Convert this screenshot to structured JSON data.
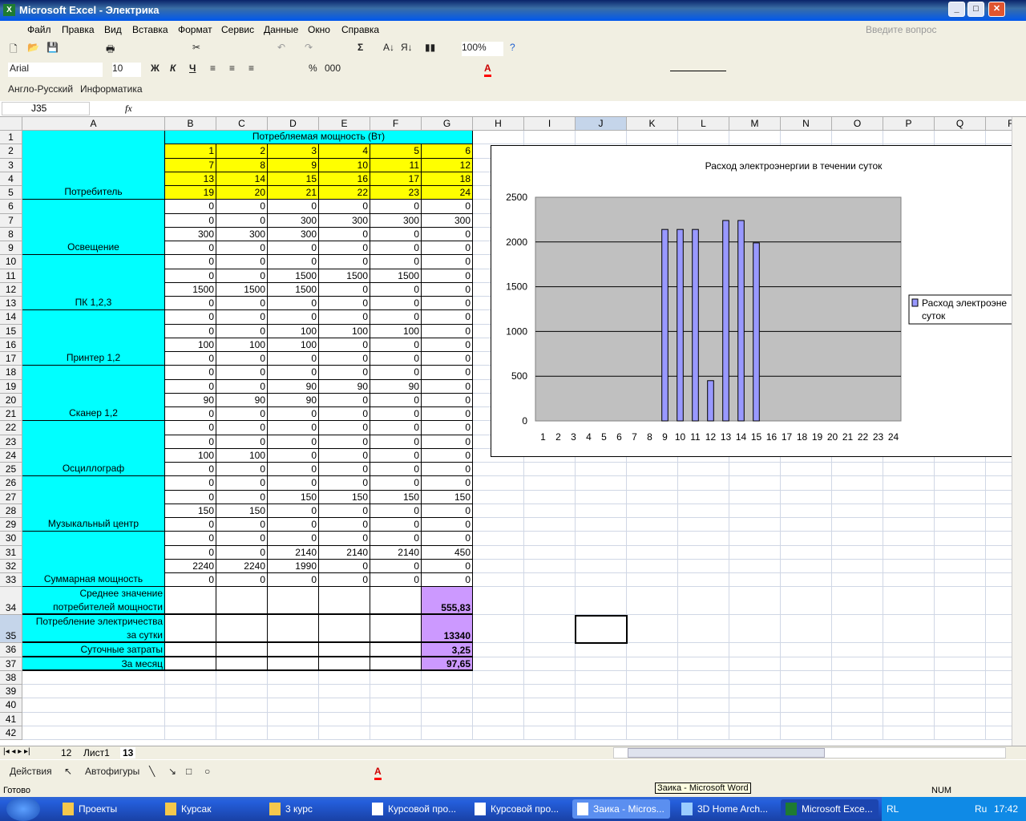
{
  "window": {
    "title": "Microsoft Excel - Электрика",
    "help_placeholder": "Введите вопрос"
  },
  "menu": [
    "Файл",
    "Правка",
    "Вид",
    "Вставка",
    "Формат",
    "Сервис",
    "Данные",
    "Окно",
    "Справка"
  ],
  "toolbar": {
    "zoom": "100%",
    "font": "Arial",
    "size": "10",
    "bold": "Ж",
    "italic": "К",
    "underline": "Ч",
    "percent": "%",
    "thousands": "000",
    "sum": "Σ"
  },
  "toolbar3": {
    "dict": "Англо-Русский",
    "info": "Информатика"
  },
  "formula": {
    "name_box": "J35",
    "fx": "fx",
    "value": ""
  },
  "columns": [
    "A",
    "B",
    "C",
    "D",
    "E",
    "F",
    "G",
    "H",
    "I",
    "J",
    "K",
    "L",
    "M",
    "N",
    "O",
    "P",
    "Q",
    "R"
  ],
  "colors": {
    "cyan": "#00FFFF",
    "yellow": "#FFFF00",
    "purple": "#CC99FF",
    "bar": "#9999FF",
    "plot": "#C0C0C0"
  },
  "sheet": {
    "header": "Потребляемая мощность (Вт)",
    "groups": [
      {
        "label": "Потребитель",
        "start": 1,
        "end": 5
      },
      {
        "label": "Освещение",
        "start": 6,
        "end": 9
      },
      {
        "label": "ПК 1,2,3",
        "start": 10,
        "end": 13
      },
      {
        "label": "Принтер 1,2",
        "start": 14,
        "end": 17
      },
      {
        "label": "Сканер 1,2",
        "start": 18,
        "end": 21
      },
      {
        "label": "Осциллограф",
        "start": 22,
        "end": 25
      },
      {
        "label": "Музыкальный центр",
        "start": 26,
        "end": 29
      },
      {
        "label": "Суммарная мощность",
        "start": 30,
        "end": 33
      }
    ],
    "rows": {
      "2": [
        "1",
        "2",
        "3",
        "4",
        "5",
        "6"
      ],
      "3": [
        "7",
        "8",
        "9",
        "10",
        "11",
        "12"
      ],
      "4": [
        "13",
        "14",
        "15",
        "16",
        "17",
        "18"
      ],
      "5": [
        "19",
        "20",
        "21",
        "22",
        "23",
        "24"
      ],
      "6": [
        "0",
        "0",
        "0",
        "0",
        "0",
        "0"
      ],
      "7": [
        "0",
        "0",
        "300",
        "300",
        "300",
        "300"
      ],
      "8": [
        "300",
        "300",
        "300",
        "0",
        "0",
        "0"
      ],
      "9": [
        "0",
        "0",
        "0",
        "0",
        "0",
        "0"
      ],
      "10": [
        "0",
        "0",
        "0",
        "0",
        "0",
        "0"
      ],
      "11": [
        "0",
        "0",
        "1500",
        "1500",
        "1500",
        "0"
      ],
      "12": [
        "1500",
        "1500",
        "1500",
        "0",
        "0",
        "0"
      ],
      "13": [
        "0",
        "0",
        "0",
        "0",
        "0",
        "0"
      ],
      "14": [
        "0",
        "0",
        "0",
        "0",
        "0",
        "0"
      ],
      "15": [
        "0",
        "0",
        "100",
        "100",
        "100",
        "0"
      ],
      "16": [
        "100",
        "100",
        "100",
        "0",
        "0",
        "0"
      ],
      "17": [
        "0",
        "0",
        "0",
        "0",
        "0",
        "0"
      ],
      "18": [
        "0",
        "0",
        "0",
        "0",
        "0",
        "0"
      ],
      "19": [
        "0",
        "0",
        "90",
        "90",
        "90",
        "0"
      ],
      "20": [
        "90",
        "90",
        "90",
        "0",
        "0",
        "0"
      ],
      "21": [
        "0",
        "0",
        "0",
        "0",
        "0",
        "0"
      ],
      "22": [
        "0",
        "0",
        "0",
        "0",
        "0",
        "0"
      ],
      "23": [
        "0",
        "0",
        "0",
        "0",
        "0",
        "0"
      ],
      "24": [
        "100",
        "100",
        "0",
        "0",
        "0",
        "0"
      ],
      "25": [
        "0",
        "0",
        "0",
        "0",
        "0",
        "0"
      ],
      "26": [
        "0",
        "0",
        "0",
        "0",
        "0",
        "0"
      ],
      "27": [
        "0",
        "0",
        "150",
        "150",
        "150",
        "150"
      ],
      "28": [
        "150",
        "150",
        "0",
        "0",
        "0",
        "0"
      ],
      "29": [
        "0",
        "0",
        "0",
        "0",
        "0",
        "0"
      ],
      "30": [
        "0",
        "0",
        "0",
        "0",
        "0",
        "0"
      ],
      "31": [
        "0",
        "0",
        "2140",
        "2140",
        "2140",
        "450"
      ],
      "32": [
        "2240",
        "2240",
        "1990",
        "0",
        "0",
        "0"
      ],
      "33": [
        "0",
        "0",
        "0",
        "0",
        "0",
        "0"
      ]
    },
    "summary": [
      {
        "row": 34,
        "label": "Среднее значение потребителей мощности",
        "value": "555,83"
      },
      {
        "row": 35,
        "label": "Потребление электричества за сутки",
        "value": "13340"
      },
      {
        "row": 36,
        "label": "Суточные затраты",
        "value": "3,25"
      },
      {
        "row": 37,
        "label": "За месяц",
        "value": "97,65"
      }
    ]
  },
  "chart_data": {
    "type": "bar",
    "title": "Расход электроэнергии в течении суток",
    "categories": [
      "1",
      "2",
      "3",
      "4",
      "5",
      "6",
      "7",
      "8",
      "9",
      "10",
      "11",
      "12",
      "13",
      "14",
      "15",
      "16",
      "17",
      "18",
      "19",
      "20",
      "21",
      "22",
      "23",
      "24"
    ],
    "series": [
      {
        "name": "Расход электроэнергии в течении суток",
        "values": [
          0,
          0,
          0,
          0,
          0,
          0,
          0,
          0,
          2140,
          2140,
          2140,
          450,
          2240,
          2240,
          1990,
          0,
          0,
          0,
          0,
          0,
          0,
          0,
          0,
          0
        ]
      }
    ],
    "legend_visible_text": [
      "Расход электроэне",
      "суток"
    ],
    "ylim": [
      0,
      2500
    ],
    "yticks": [
      "0",
      "500",
      "1000",
      "1500",
      "2000",
      "2500"
    ],
    "grid": true,
    "legend": "right"
  },
  "sheet_tabs": [
    "12",
    "Лист1",
    "13"
  ],
  "drawing": {
    "actions": "Действия",
    "autoshapes": "Автофигуры"
  },
  "status": {
    "ready": "Готово",
    "num": "NUM",
    "tooltip": "Заика - Microsoft Word"
  },
  "taskbar": {
    "items": [
      "Проекты",
      "Курсак",
      "3 курс",
      "Курсовой про...",
      "Курсовой про...",
      "Заика - Micros...",
      "3D Home Arch...",
      "Microsoft Exce..."
    ],
    "lang_tray": "RL",
    "lang": "Ru",
    "time": "17:42"
  }
}
